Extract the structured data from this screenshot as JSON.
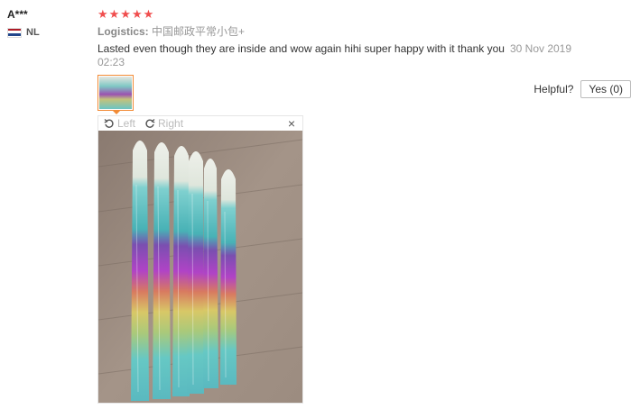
{
  "user": {
    "name": "A***",
    "country": "NL"
  },
  "review": {
    "stars": "★★★★★",
    "logistics_label": "Logistics:",
    "logistics_value": "中国邮政平常小包+",
    "text": "Lasted even though they are inside and wow again hihi super happy with it thank you",
    "date": "30 Nov 2019 02:23"
  },
  "helpful": {
    "label": "Helpful?",
    "yes_button": "Yes (0)"
  },
  "viewer": {
    "rotate_left": "Left",
    "rotate_right": "Right",
    "close": "×"
  },
  "colors": {
    "star": "#f04e4e",
    "thumb_border": "#f28b36"
  }
}
